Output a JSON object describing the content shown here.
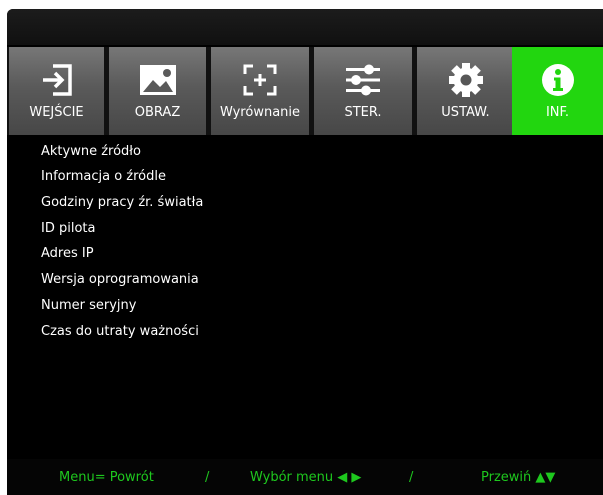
{
  "tabs": [
    {
      "label": "WEJŚCIE",
      "icon": "input-icon",
      "active": false
    },
    {
      "label": "OBRAZ",
      "icon": "image-icon",
      "active": false
    },
    {
      "label": "Wyrównanie",
      "icon": "alignment-icon",
      "active": false
    },
    {
      "label": "STER.",
      "icon": "sliders-icon",
      "active": false
    },
    {
      "label": "USTAW.",
      "icon": "gear-icon",
      "active": false
    },
    {
      "label": "INF.",
      "icon": "info-icon",
      "active": true
    }
  ],
  "menu": {
    "items": [
      "Aktywne źródło",
      "Informacja o źródle",
      "Godziny pracy źr. światła",
      "ID pilota",
      "Adres IP",
      "Wersja oprogramowania",
      "Numer seryjny",
      "Czas do utraty ważności"
    ]
  },
  "footer": {
    "menu_back": "Menu= Powrót",
    "sep1": "/",
    "select": "Wybór menu ◀ ▶",
    "sep2": "/",
    "scroll": "Przewiń ▲▼"
  },
  "colors": {
    "active_tab": "#22d60f",
    "footer_text": "#1ec81e"
  }
}
